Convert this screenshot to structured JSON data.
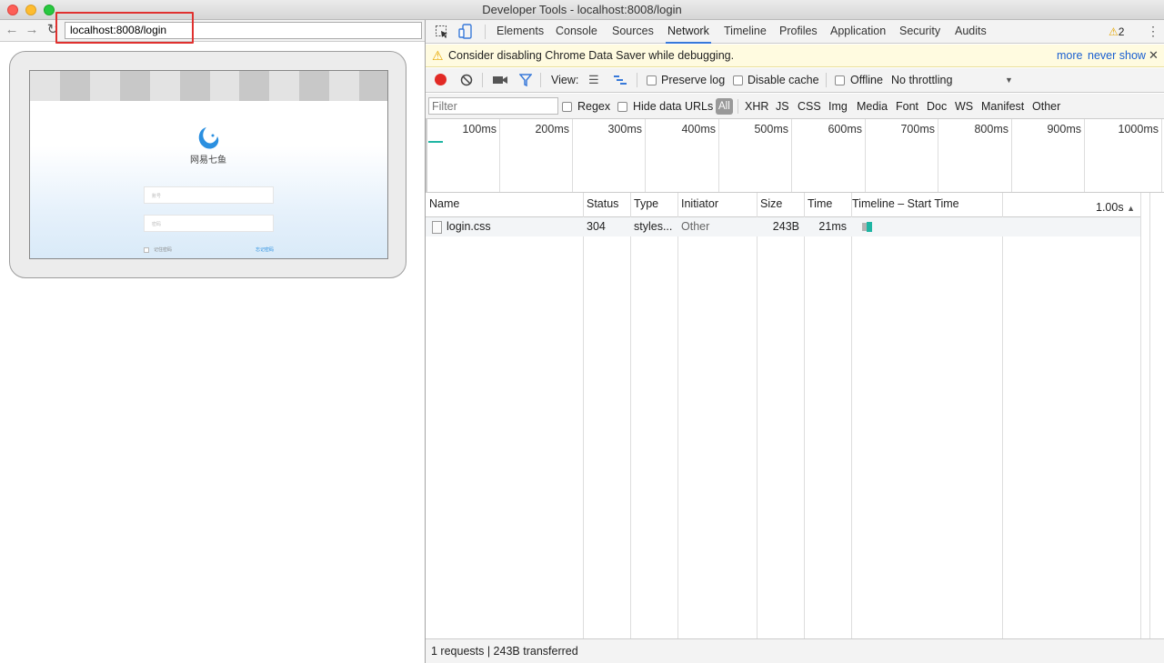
{
  "window": {
    "title": "Developer Tools - localhost:8008/login"
  },
  "browser": {
    "url": "localhost:8008/login"
  },
  "preview": {
    "logo_text": "网易七鱼",
    "username_placeholder": "账号",
    "password_placeholder": "密码",
    "remember_label": "记住密码",
    "forgot_label": "忘记密码"
  },
  "devtools": {
    "tabs": [
      "Elements",
      "Console",
      "Sources",
      "Network",
      "Timeline",
      "Profiles",
      "Application",
      "Security",
      "Audits"
    ],
    "active_tab": "Network",
    "warning_count": "2",
    "warning": {
      "message": "Consider disabling Chrome Data Saver while debugging.",
      "more": "more",
      "never_show": "never show"
    },
    "toolbar": {
      "view_label": "View:",
      "preserve_log": "Preserve log",
      "disable_cache": "Disable cache",
      "offline": "Offline",
      "throttling": "No throttling"
    },
    "filter": {
      "placeholder": "Filter",
      "regex": "Regex",
      "hide_data_urls": "Hide data URLs",
      "types": [
        "All",
        "XHR",
        "JS",
        "CSS",
        "Img",
        "Media",
        "Font",
        "Doc",
        "WS",
        "Manifest",
        "Other"
      ]
    },
    "overview_ticks": [
      "100ms",
      "200ms",
      "300ms",
      "400ms",
      "500ms",
      "600ms",
      "700ms",
      "800ms",
      "900ms",
      "1000ms"
    ],
    "columns": {
      "name": "Name",
      "status": "Status",
      "type": "Type",
      "initiator": "Initiator",
      "size": "Size",
      "time": "Time",
      "timeline": "Timeline – Start Time",
      "timeline_end": "1.00s"
    },
    "requests": [
      {
        "name": "login.css",
        "status": "304",
        "type": "styles...",
        "initiator": "Other",
        "size": "243B",
        "time": "21ms"
      }
    ],
    "status_text": "1 requests | 243B transferred"
  },
  "colors": {
    "record": "#e22a25",
    "accent": "#3879d9",
    "warning_bg": "#fffbe0",
    "highlight": "#e0312f",
    "bar": "#1fb5a3"
  }
}
